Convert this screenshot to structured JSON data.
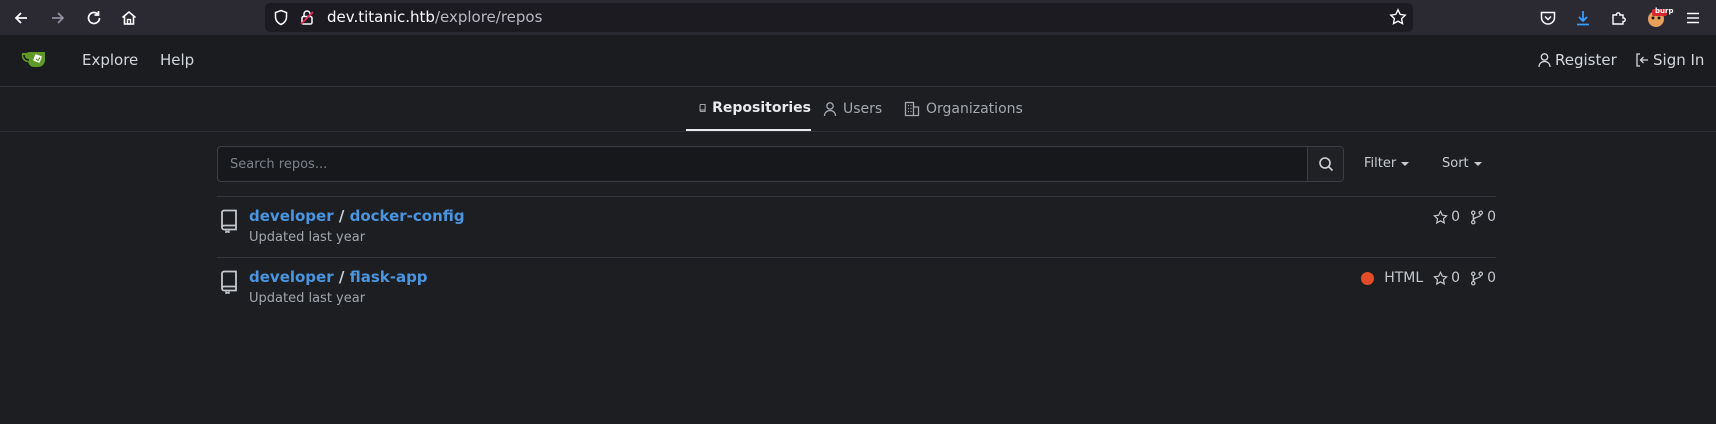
{
  "browser": {
    "url_host": "dev.titanic.htb",
    "url_path": "/explore/repos",
    "ext_badge": "burp"
  },
  "header": {
    "nav": [
      "Explore",
      "Help"
    ],
    "register": "Register",
    "sign_in": "Sign In"
  },
  "tabs": [
    {
      "label": "Repositories",
      "active": true
    },
    {
      "label": "Users",
      "active": false
    },
    {
      "label": "Organizations",
      "active": false
    }
  ],
  "search": {
    "placeholder": "Search repos...",
    "filter_label": "Filter",
    "sort_label": "Sort"
  },
  "repos": [
    {
      "owner": "developer",
      "separator": "/",
      "name": "docker-config",
      "updated": "Updated last year",
      "language": "",
      "stars": "0",
      "forks": "0"
    },
    {
      "owner": "developer",
      "separator": "/",
      "name": "flask-app",
      "updated": "Updated last year",
      "language": "HTML",
      "language_color": "#e34c26",
      "stars": "0",
      "forks": "0"
    }
  ],
  "colors": {
    "accent": "#4b95e0",
    "gitea_green": "#609926"
  }
}
